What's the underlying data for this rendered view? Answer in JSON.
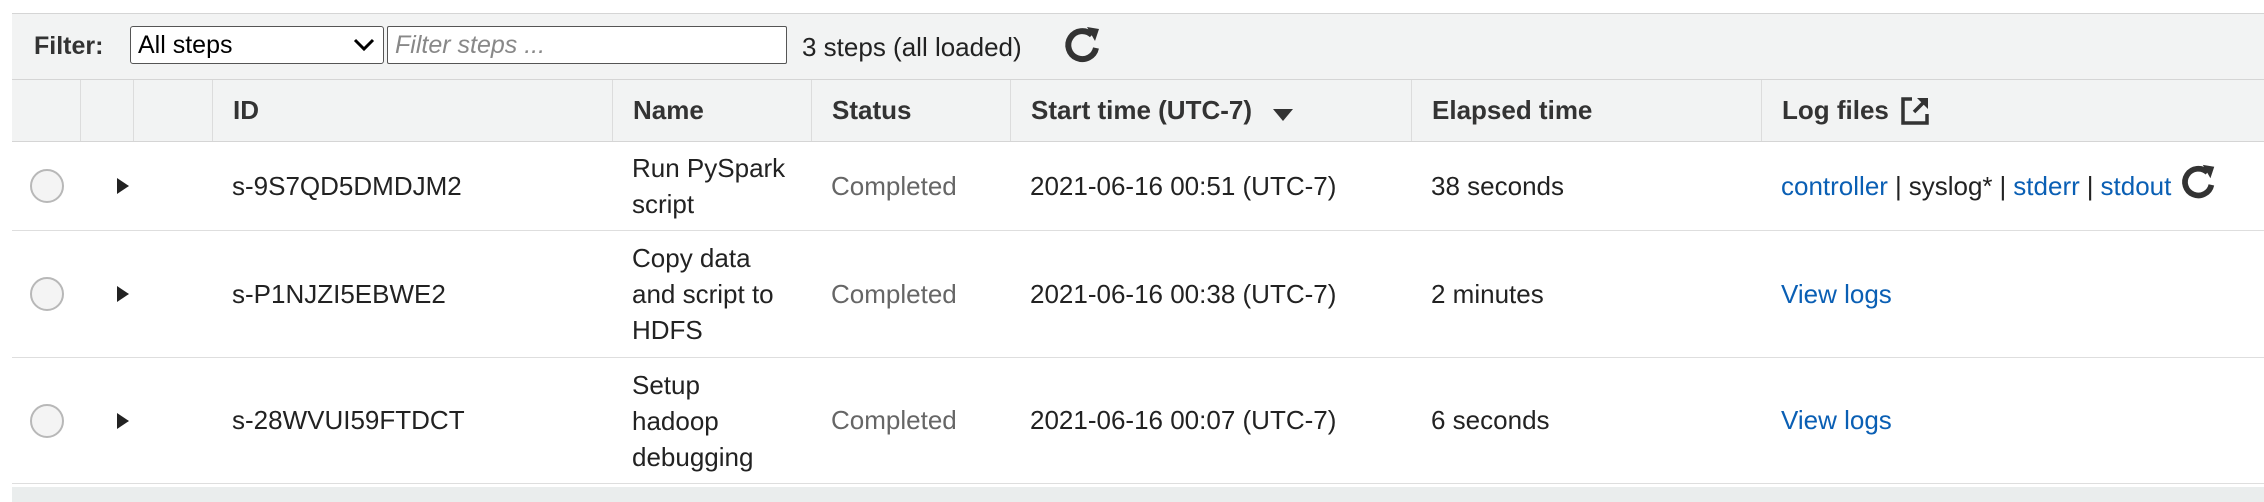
{
  "filter": {
    "label": "Filter:",
    "selected": "All steps",
    "placeholder": "Filter steps ...",
    "count_text": "3 steps (all loaded)"
  },
  "columns": {
    "id": "ID",
    "name": "Name",
    "status": "Status",
    "start_time": "Start time (UTC-7)",
    "elapsed": "Elapsed time",
    "log_files": "Log files"
  },
  "rows": [
    {
      "id": "s-9S7QD5DMDJM2",
      "name_lines": [
        "Run PySpark",
        "script"
      ],
      "status": "Completed",
      "start_time": "2021-06-16 00:51 (UTC-7)",
      "elapsed": "38 seconds",
      "logs": {
        "controller": "controller",
        "syslog": "syslog*",
        "stderr": "stderr",
        "stdout": "stdout",
        "sep": "|"
      }
    },
    {
      "id": "s-P1NJZI5EBWE2",
      "name_lines": [
        "Copy data",
        "and script to",
        "HDFS"
      ],
      "status": "Completed",
      "start_time": "2021-06-16 00:38 (UTC-7)",
      "elapsed": "2 minutes",
      "view_logs": "View logs"
    },
    {
      "id": "s-28WVUI59FTDCT",
      "name_lines": [
        "Setup",
        "hadoop",
        "debugging"
      ],
      "status": "Completed",
      "start_time": "2021-06-16 00:07 (UTC-7)",
      "elapsed": "6 seconds",
      "view_logs": "View logs"
    }
  ],
  "colors": {
    "link": "#0a5fb4",
    "header_bg": "#f2f3f3",
    "status_text": "#666666"
  },
  "icons": [
    "chevron-down-icon",
    "refresh-icon",
    "sort-desc-icon",
    "external-link-icon",
    "expand-caret-icon"
  ]
}
